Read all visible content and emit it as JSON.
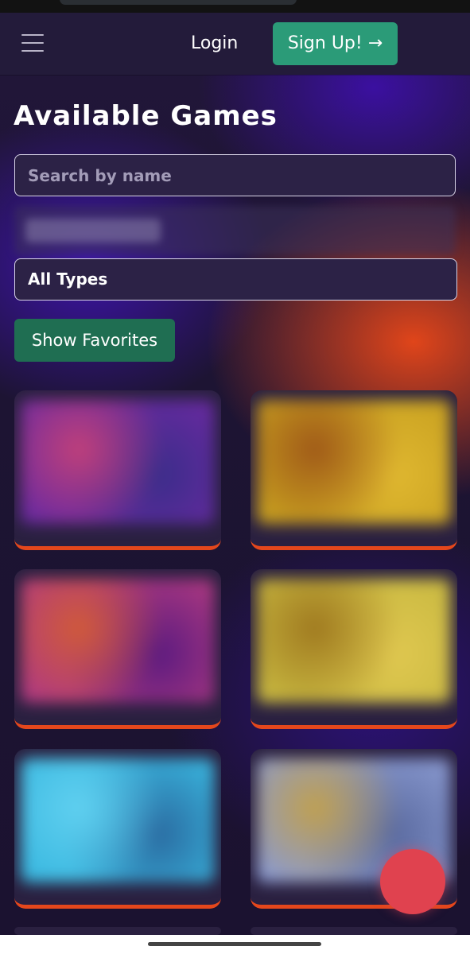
{
  "header": {
    "menu_icon": "hamburger-menu-icon",
    "login_label": "Login",
    "signup_label": "Sign Up! →"
  },
  "main": {
    "title": "Available Games",
    "search": {
      "placeholder": "Search by name",
      "value": ""
    },
    "type_filter": {
      "selected": "All Types"
    },
    "favorites_label": "Show Favorites"
  },
  "games": [
    {
      "thumb_colors": [
        "#6a2aa0",
        "#c0407a",
        "#3a2d8a"
      ]
    },
    {
      "thumb_colors": [
        "#c8a020",
        "#a05a18",
        "#e0b830"
      ]
    },
    {
      "thumb_colors": [
        "#b03a80",
        "#d05a3a",
        "#5a1a80"
      ]
    },
    {
      "thumb_colors": [
        "#c8b840",
        "#a07a20",
        "#e0c850"
      ]
    },
    {
      "thumb_colors": [
        "#3ab8e0",
        "#60d0f0",
        "#2a6aa0"
      ]
    },
    {
      "thumb_colors": [
        "#8a9ad0",
        "#c0a050",
        "#5a6aa0"
      ]
    }
  ],
  "colors": {
    "accent_green": "#2b9b78",
    "favorites_green": "#1f6e52",
    "card_underline": "#e4471c",
    "fab": "#e0424f"
  }
}
